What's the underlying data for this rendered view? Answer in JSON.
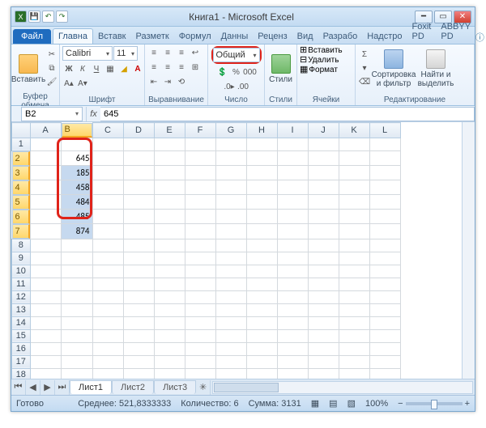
{
  "window": {
    "title": "Книга1 - Microsoft Excel"
  },
  "tabs": {
    "file": "Файл",
    "items": [
      "Главна",
      "Вставк",
      "Разметк",
      "Формул",
      "Данны",
      "Реценз",
      "Вид",
      "Разрабо",
      "Надстро",
      "Foxit PD",
      "ABBYY PD"
    ],
    "active_index": 0
  },
  "ribbon": {
    "clipboard": {
      "paste": "Вставить",
      "label": "Буфер обмена"
    },
    "font": {
      "name": "Calibri",
      "size": "11",
      "label": "Шрифт"
    },
    "align": {
      "label": "Выравнивание"
    },
    "number": {
      "format": "Общий",
      "label": "Число"
    },
    "styles": {
      "styles": "Стили",
      "label": "Стили"
    },
    "cells": {
      "insert": "Вставить",
      "delete": "Удалить",
      "format": "Формат",
      "label": "Ячейки"
    },
    "edit": {
      "sort": "Сортировка\nи фильтр",
      "find": "Найти и\nвыделить",
      "label": "Редактирование"
    }
  },
  "formula": {
    "cell_ref": "B2",
    "fx": "fx",
    "value": "645"
  },
  "grid": {
    "columns": [
      "A",
      "B",
      "C",
      "D",
      "E",
      "F",
      "G",
      "H",
      "I",
      "J",
      "K",
      "L"
    ],
    "active_col": "B",
    "rows": 27,
    "selected_range": {
      "col": "B",
      "r1": 2,
      "r2": 7
    },
    "data": {
      "B2": "645",
      "B3": "185",
      "B4": "458",
      "B5": "484",
      "B6": "485",
      "B7": "874"
    }
  },
  "sheets": {
    "tabs": [
      "Лист1",
      "Лист2",
      "Лист3"
    ],
    "active": 0
  },
  "status": {
    "ready": "Готово",
    "avg_label": "Среднее:",
    "avg": "521,8333333",
    "count_label": "Количество:",
    "count": "6",
    "sum_label": "Сумма:",
    "sum": "3131",
    "zoom": "100%"
  }
}
